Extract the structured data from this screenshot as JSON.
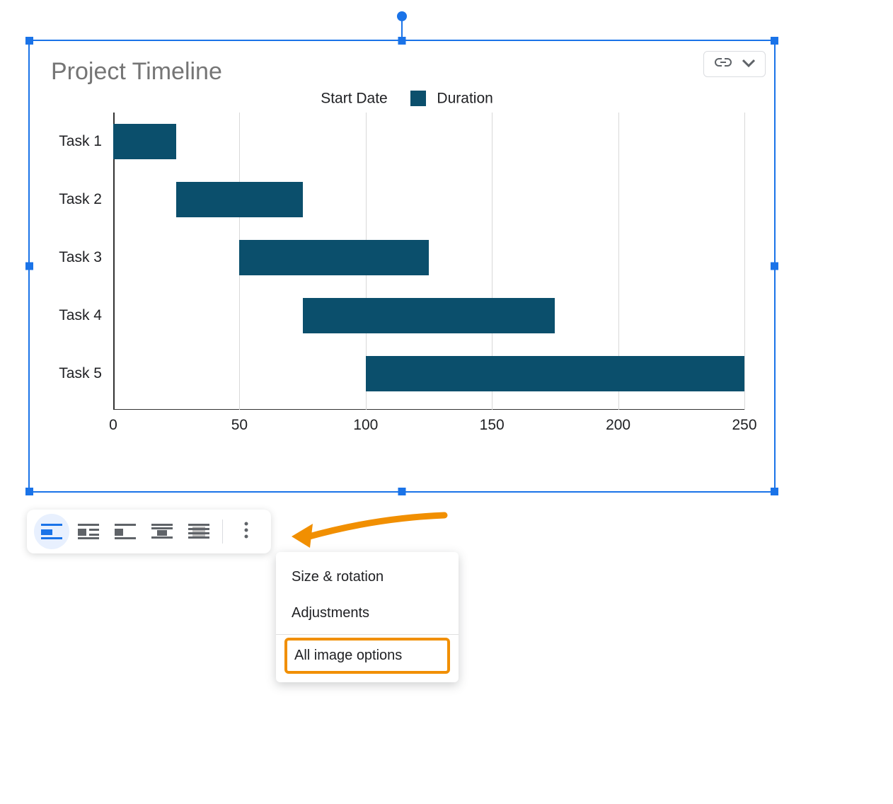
{
  "chart_data": {
    "type": "bar",
    "title": "Project Timeline",
    "categories": [
      "Task 1",
      "Task 2",
      "Task 3",
      "Task 4",
      "Task 5"
    ],
    "series": [
      {
        "name": "Start Date",
        "values": [
          0,
          25,
          50,
          75,
          100
        ]
      },
      {
        "name": "Duration",
        "values": [
          25,
          50,
          75,
          100,
          150
        ]
      }
    ],
    "xlim": [
      0,
      250
    ],
    "xticks": [
      0,
      50,
      100,
      150,
      200,
      250
    ],
    "bar_color": "#0b4f6c"
  },
  "toolbar": {
    "buttons": [
      {
        "name": "inline-wrap-button"
      },
      {
        "name": "wrap-right-button"
      },
      {
        "name": "wrap-left-button"
      },
      {
        "name": "break-text-button"
      },
      {
        "name": "behind-text-button"
      }
    ]
  },
  "menu": {
    "items": [
      {
        "label": "Size & rotation"
      },
      {
        "label": "Adjustments"
      }
    ],
    "highlighted": {
      "label": "All image options"
    }
  },
  "colors": {
    "selection": "#1a73e8",
    "highlight": "#f18f01"
  }
}
